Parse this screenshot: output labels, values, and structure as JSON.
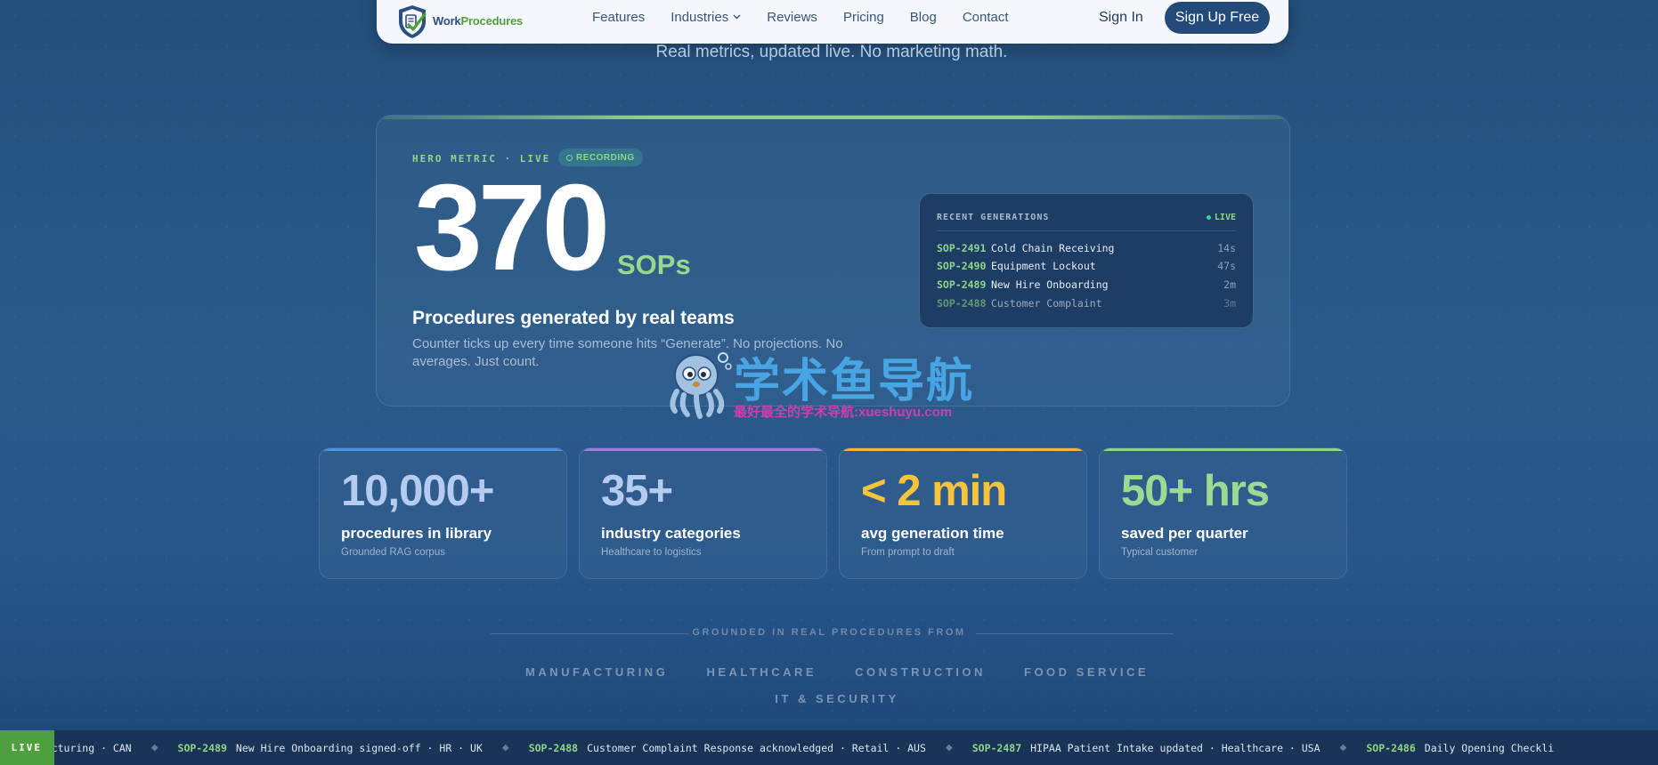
{
  "nav": {
    "logo_work": "Work",
    "logo_procedures": "Procedures",
    "links": [
      {
        "label": "Features"
      },
      {
        "label": "Industries",
        "has_dropdown": true
      },
      {
        "label": "Reviews"
      },
      {
        "label": "Pricing"
      },
      {
        "label": "Blog"
      },
      {
        "label": "Contact"
      }
    ],
    "sign_in": "Sign In",
    "sign_up": "Sign Up Free"
  },
  "subtitle": "Real metrics, updated live. No marketing math.",
  "hero": {
    "label": "HERO METRIC · LIVE",
    "badge": "RECORDING",
    "value": "370",
    "unit": "SOPs",
    "heading": "Procedures generated by real teams",
    "description": "Counter ticks up every time someone hits “Generate”. No projections. No averages. Just count.",
    "recent": {
      "title": "RECENT GENERATIONS",
      "live": "LIVE",
      "rows": [
        {
          "id": "SOP-2491",
          "name": "Cold Chain Receiving",
          "time": "14s"
        },
        {
          "id": "SOP-2490",
          "name": "Equipment Lockout",
          "time": "47s"
        },
        {
          "id": "SOP-2489",
          "name": "New Hire Onboarding",
          "time": "2m"
        },
        {
          "id": "SOP-2488",
          "name": "Customer Complaint",
          "time": "3m"
        }
      ]
    }
  },
  "stats": [
    {
      "value": "10,000+",
      "label": "procedures in library",
      "sub": "Grounded RAG corpus",
      "color": "#b5ccf0",
      "accent": "#4f8fe0"
    },
    {
      "value": "35+",
      "label": "industry categories",
      "sub": "Healthcare to logistics",
      "color": "#b5ccf0",
      "accent": "#a07be0"
    },
    {
      "value": "< 2 min",
      "label": "avg generation time",
      "sub": "From prompt to draft",
      "color": "#f5c43a",
      "accent": "#f0b83a"
    },
    {
      "value": "50+ hrs",
      "label": "saved per quarter",
      "sub": "Typical customer",
      "color": "#9ed992",
      "accent": "#8fd48a"
    }
  ],
  "sources": {
    "title": "GROUNDED IN REAL PROCEDURES FROM",
    "industries": [
      "MANUFACTURING",
      "HEALTHCARE",
      "CONSTRUCTION",
      "FOOD SERVICE",
      "IT & SECURITY"
    ]
  },
  "ticker": {
    "badge": "LIVE",
    "items": [
      {
        "id": "",
        "text": "nufacturing · CAN"
      },
      {
        "id": "SOP-2489",
        "text": "New Hire Onboarding signed-off · HR · UK"
      },
      {
        "id": "SOP-2488",
        "text": "Customer Complaint Response acknowledged · Retail · AUS"
      },
      {
        "id": "SOP-2487",
        "text": "HIPAA Patient Intake updated · Healthcare · USA"
      },
      {
        "id": "SOP-2486",
        "text": "Daily Opening Checkli"
      }
    ]
  },
  "watermark": {
    "title": "学术鱼导航",
    "subtitle": "最好最全的学术导航:xueshuyu.com"
  }
}
